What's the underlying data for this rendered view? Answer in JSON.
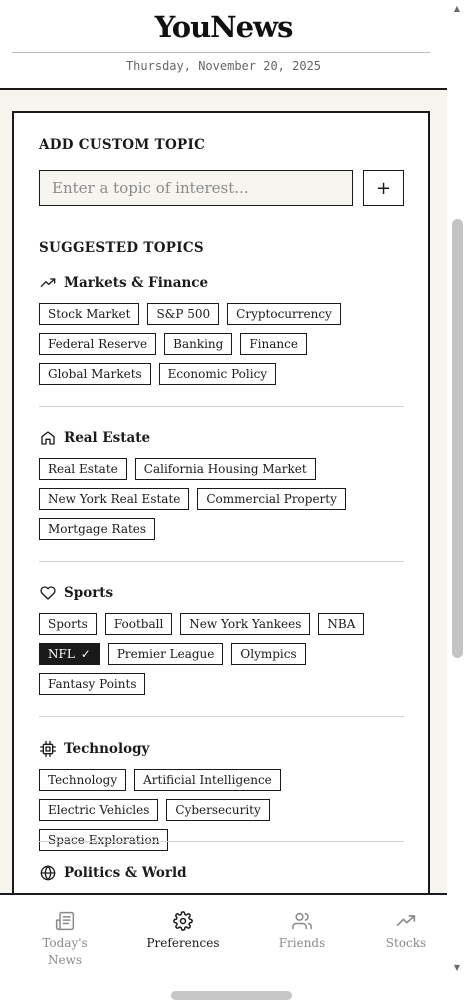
{
  "header": {
    "brand": "YouNews",
    "date": "Thursday, November 20, 2025"
  },
  "custom_topic": {
    "title": "ADD CUSTOM TOPIC",
    "input_value": "",
    "placeholder": "Enter a topic of interest...",
    "add_label": "+"
  },
  "suggested": {
    "title": "SUGGESTED TOPICS",
    "categories": [
      {
        "label": "Markets & Finance",
        "icon": "trending-up-icon",
        "topics": [
          {
            "label": "Stock Market",
            "selected": false
          },
          {
            "label": "S&P 500",
            "selected": false
          },
          {
            "label": "Cryptocurrency",
            "selected": false
          },
          {
            "label": "Federal Reserve",
            "selected": false
          },
          {
            "label": "Banking",
            "selected": false
          },
          {
            "label": "Finance",
            "selected": false
          },
          {
            "label": "Global Markets",
            "selected": false
          },
          {
            "label": "Economic Policy",
            "selected": false
          }
        ]
      },
      {
        "label": "Real Estate",
        "icon": "home-icon",
        "topics": [
          {
            "label": "Real Estate",
            "selected": false
          },
          {
            "label": "California Housing Market",
            "selected": false
          },
          {
            "label": "New York Real Estate",
            "selected": false
          },
          {
            "label": "Commercial Property",
            "selected": false
          },
          {
            "label": "Mortgage Rates",
            "selected": false
          }
        ]
      },
      {
        "label": "Sports",
        "icon": "heart-icon",
        "topics": [
          {
            "label": "Sports",
            "selected": false
          },
          {
            "label": "Football",
            "selected": false
          },
          {
            "label": "New York Yankees",
            "selected": false
          },
          {
            "label": "NBA",
            "selected": false
          },
          {
            "label": "NFL",
            "selected": true
          },
          {
            "label": "Premier League",
            "selected": false
          },
          {
            "label": "Olympics",
            "selected": false
          },
          {
            "label": "Fantasy Points",
            "selected": false
          }
        ]
      },
      {
        "label": "Technology",
        "icon": "cpu-icon",
        "topics": [
          {
            "label": "Technology",
            "selected": false
          },
          {
            "label": "Artificial Intelligence",
            "selected": false
          },
          {
            "label": "Electric Vehicles",
            "selected": false
          },
          {
            "label": "Cybersecurity",
            "selected": false
          },
          {
            "label": "Space Exploration",
            "selected": false
          }
        ]
      },
      {
        "label": "Politics & World",
        "icon": "globe-icon",
        "topics": []
      }
    ],
    "check_glyph": "✓"
  },
  "nav": {
    "items": [
      {
        "label": "Today's News",
        "icon": "newspaper-icon",
        "active": false
      },
      {
        "label": "Preferences",
        "icon": "gear-icon",
        "active": true
      },
      {
        "label": "Friends",
        "icon": "users-icon",
        "active": false
      },
      {
        "label": "Stocks",
        "icon": "trending-up-icon",
        "active": false
      }
    ]
  },
  "colors": {
    "ink": "#1a1a1a",
    "paper": "#f7f5ef",
    "muted": "#8a8a8a"
  }
}
